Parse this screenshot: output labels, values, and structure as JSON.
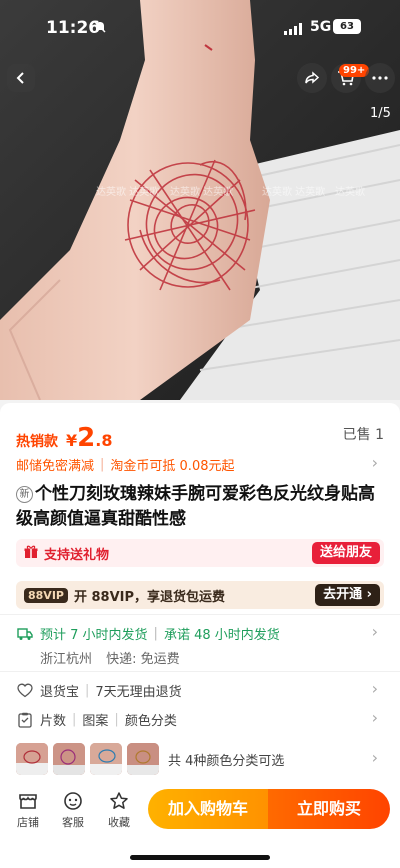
{
  "status_bar": {
    "time": "11:26",
    "network": "5G",
    "battery": "63"
  },
  "header": {
    "cart_badge": "99+",
    "page_indicator": "1/5"
  },
  "hero": {
    "watermark": "达英歌"
  },
  "price": {
    "hot_label": "热销款",
    "currency": "¥",
    "integer": "2",
    "decimal": ".8",
    "sold": "已售 1"
  },
  "promotions": {
    "items": [
      "邮储免密满减",
      "淘金币可抵 0.08元起"
    ]
  },
  "product": {
    "new_tag": "新",
    "title": "个性刀刻玫瑰辣妹手腕可爱彩色反光纹身贴高级高颜值逼真甜酷性感"
  },
  "gift": {
    "text": "支持送礼物",
    "button": "送给朋友"
  },
  "vip": {
    "tag": "88VIP",
    "text": "开 88VIP，享退货包运费",
    "button": "去开通"
  },
  "shipping": {
    "estimate": "预计 7 小时内发货",
    "promise": "承诺 48 小时内发货",
    "origin": "浙江杭州",
    "delivery": "快递: 免运费"
  },
  "returns": {
    "label": "退货宝",
    "policy": "7天无理由退货"
  },
  "specs": {
    "items": [
      "片数",
      "图案",
      "颜色分类"
    ]
  },
  "variants": {
    "summary": "共 4种颜色分类可选"
  },
  "bottom_bar": {
    "store": "店铺",
    "service": "客服",
    "favorite": "收藏",
    "add_to_cart": "加入购物车",
    "buy_now": "立即购买"
  },
  "colors": {
    "accent": "#ff4400",
    "cart_orange": "#ffa500",
    "green": "#1f9e5c",
    "gift_red": "#e8203a"
  }
}
